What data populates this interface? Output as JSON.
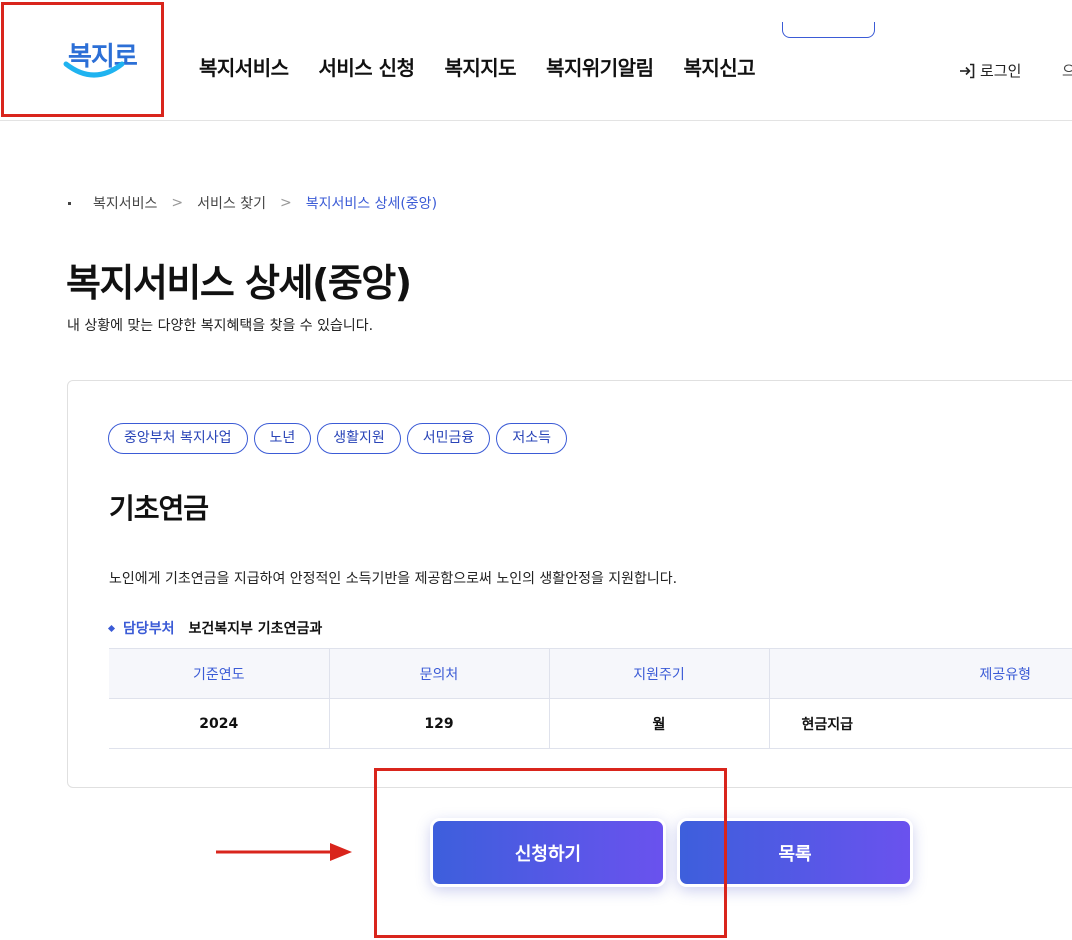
{
  "header": {
    "logo_text": "복지로",
    "nav": [
      "복지서비스",
      "서비스 신청",
      "복지지도",
      "복지위기알림",
      "복지신고"
    ],
    "login_label": "로그인",
    "user_cut_label": "으"
  },
  "breadcrumb": [
    "복지서비스",
    "서비스 찾기",
    "복지서비스 상세(중앙)"
  ],
  "page": {
    "title": "복지서비스 상세(중앙)",
    "description": "내 상황에 맞는 다양한 복지혜택을 찾을 수 있습니다."
  },
  "service": {
    "tags": [
      "중앙부처 복지사업",
      "노년",
      "생활지원",
      "서민금융",
      "저소득"
    ],
    "title": "기초연금",
    "description": "노인에게 기초연금을 지급하여 안정적인 소득기반을 제공함으로써 노인의 생활안정을 지원합니다.",
    "dept_label": "담당부처",
    "dept_value": "보건복지부 기초연금과",
    "table": {
      "headers": [
        "기준연도",
        "문의처",
        "지원주기",
        "제공유형"
      ],
      "row": [
        "2024",
        "129",
        "월",
        "현금지급"
      ]
    }
  },
  "buttons": {
    "apply": "신청하기",
    "list": "목록"
  },
  "colors": {
    "accent": "#3b5bd6",
    "annotation": "#d9251c"
  }
}
